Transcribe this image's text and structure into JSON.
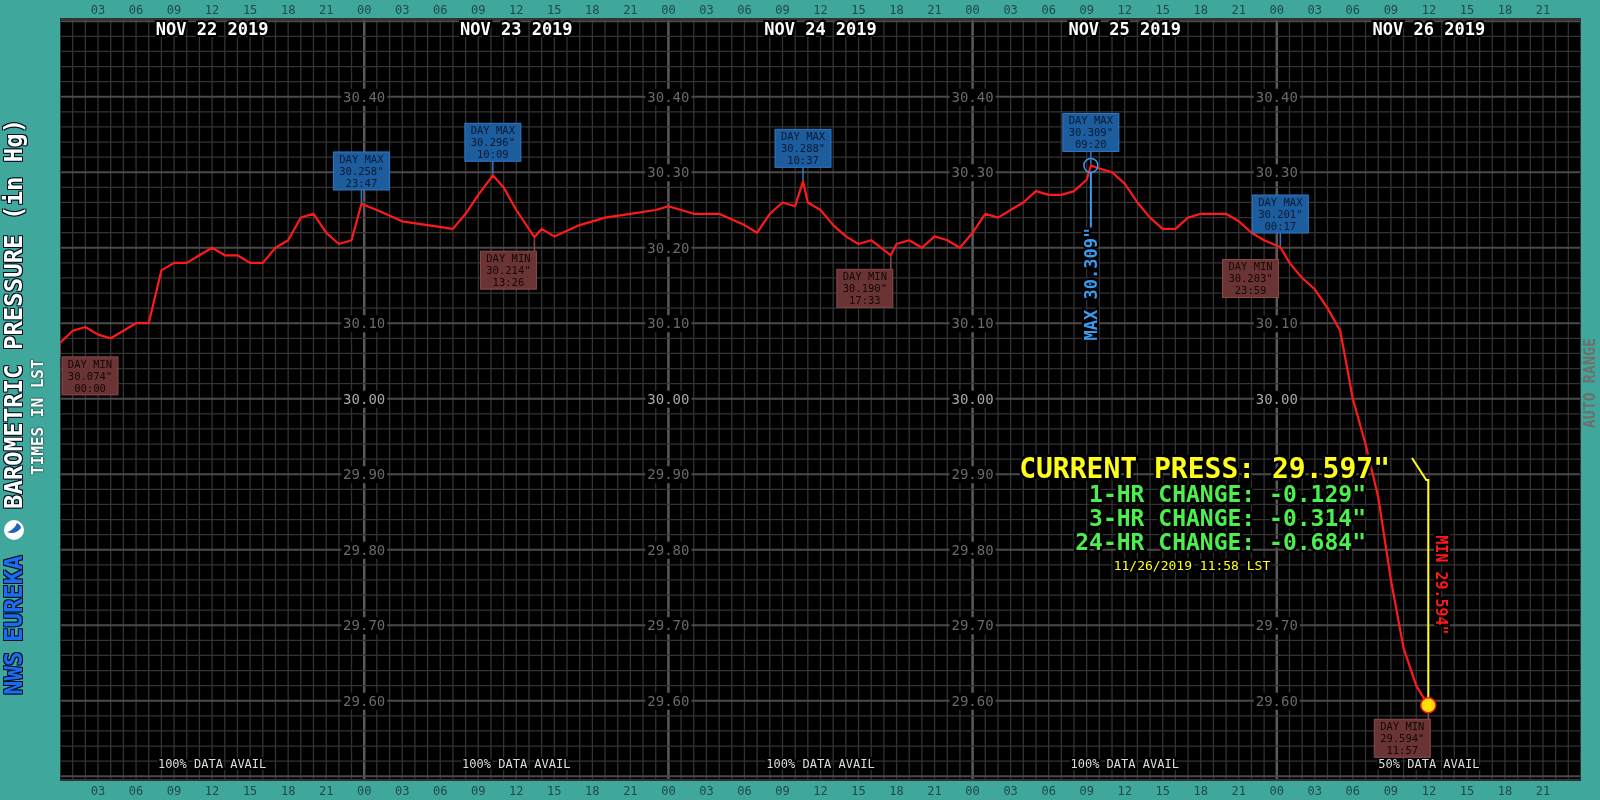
{
  "sidebar": {
    "station": "NWS",
    "office": "EUREKA",
    "title": "BAROMETRIC PRESSURE (in Hg)",
    "subtitle": "TIMES IN LST"
  },
  "right_bar": {
    "label": "AUTO RANGE"
  },
  "chart": {
    "days": [
      {
        "date": "NOV 22 2019",
        "availability": "100% DATA AVAIL",
        "max_tag": [
          "DAY MAX",
          "30.258\"",
          "23:47"
        ],
        "min_tag": [
          "DAY MIN",
          "30.074\"",
          "00:00"
        ]
      },
      {
        "date": "NOV 23 2019",
        "availability": "100% DATA AVAIL",
        "max_tag": [
          "DAY MAX",
          "30.296\"",
          "10:09"
        ],
        "min_tag": [
          "DAY MIN",
          "30.214\"",
          "13:26"
        ]
      },
      {
        "date": "NOV 24 2019",
        "availability": "100% DATA AVAIL",
        "max_tag": [
          "DAY MAX",
          "30.288\"",
          "10:37"
        ],
        "min_tag": [
          "DAY MIN",
          "30.190\"",
          "17:33"
        ]
      },
      {
        "date": "NOV 25 2019",
        "availability": "100% DATA AVAIL",
        "max_tag": [
          "DAY MAX",
          "30.309\"",
          "09:20"
        ],
        "min_tag": [
          "DAY MIN",
          "30.203\"",
          "23:59"
        ]
      },
      {
        "date": "NOV 26 2019",
        "availability": "50% DATA AVAIL",
        "max_tag": [
          "DAY MAX",
          "30.201\"",
          "00:17"
        ],
        "min_tag": [
          "DAY MIN",
          "29.594\"",
          "11:57"
        ]
      }
    ],
    "current": {
      "label": "CURRENT PRESS:",
      "value": "29.597\""
    },
    "changes": [
      {
        "label": "1-HR CHANGE:",
        "value": "-0.129\""
      },
      {
        "label": "3-HR CHANGE:",
        "value": "-0.314\""
      },
      {
        "label": "24-HR CHANGE:",
        "value": "-0.684\""
      }
    ],
    "timestamp": "11/26/2019 11:58 LST",
    "max_label": "MAX 30.309\"",
    "min_label": "MIN 29.594\"",
    "chart_data": {
      "type": "line",
      "grid": true,
      "xlim": [
        0,
        120
      ],
      "ylim": [
        29.495,
        30.503
      ],
      "x": [
        0,
        1,
        2,
        3,
        4,
        5,
        6,
        7,
        8,
        9,
        10,
        11,
        12,
        13,
        14,
        15,
        16,
        17,
        18,
        19,
        20,
        21,
        22,
        23,
        23.78,
        25,
        27,
        29,
        31,
        32,
        33,
        34.15,
        35,
        36,
        37.43,
        38,
        39,
        41,
        43,
        45,
        47,
        48,
        50,
        52,
        54,
        55,
        56,
        57,
        58,
        58.62,
        59,
        60,
        61,
        62,
        63,
        64,
        65.55,
        66,
        67,
        68,
        69,
        70,
        71,
        72,
        73,
        74,
        75,
        76,
        77,
        78,
        79,
        80,
        81,
        81.33,
        82,
        83,
        84,
        85,
        86,
        87,
        88,
        89,
        90,
        91,
        92,
        93,
        94,
        95,
        95.98,
        96.28,
        97,
        98,
        99,
        100,
        101,
        102,
        103,
        104,
        105,
        106,
        107,
        107.95,
        108
      ],
      "series": [
        {
          "color": "#ff1a1a",
          "values": [
            30.074,
            30.09,
            30.095,
            30.085,
            30.08,
            30.09,
            30.1,
            30.1,
            30.17,
            30.18,
            30.18,
            30.19,
            30.2,
            30.19,
            30.19,
            30.18,
            30.18,
            30.2,
            30.21,
            30.24,
            30.245,
            30.22,
            30.205,
            30.21,
            30.258,
            30.25,
            30.235,
            30.23,
            30.225,
            30.245,
            30.27,
            30.296,
            30.28,
            30.25,
            30.214,
            30.225,
            30.215,
            30.23,
            30.24,
            30.245,
            30.25,
            30.255,
            30.245,
            30.245,
            30.23,
            30.22,
            30.245,
            30.26,
            30.255,
            30.288,
            30.26,
            30.25,
            30.23,
            30.215,
            30.205,
            30.21,
            30.19,
            30.205,
            30.21,
            30.2,
            30.215,
            30.21,
            30.2,
            30.22,
            30.245,
            30.24,
            30.25,
            30.26,
            30.275,
            30.27,
            30.27,
            30.275,
            30.29,
            30.309,
            30.305,
            30.3,
            30.285,
            30.26,
            30.24,
            30.225,
            30.225,
            30.24,
            30.245,
            30.245,
            30.245,
            30.235,
            30.22,
            30.21,
            30.203,
            30.201,
            30.18,
            30.16,
            30.145,
            30.12,
            30.09,
            30.0,
            29.94,
            29.87,
            29.76,
            29.67,
            29.62,
            29.594,
            29.597
          ]
        }
      ],
      "xticks": [
        {
          "value": 3,
          "label": "03"
        },
        {
          "value": 6,
          "label": "06"
        },
        {
          "value": 9,
          "label": "09"
        },
        {
          "value": 12,
          "label": "12"
        },
        {
          "value": 15,
          "label": "15"
        },
        {
          "value": 18,
          "label": "18"
        },
        {
          "value": 21,
          "label": "21"
        },
        {
          "value": 24,
          "label": "00"
        },
        {
          "value": 27,
          "label": "03"
        },
        {
          "value": 30,
          "label": "06"
        },
        {
          "value": 33,
          "label": "09"
        },
        {
          "value": 36,
          "label": "12"
        },
        {
          "value": 39,
          "label": "15"
        },
        {
          "value": 42,
          "label": "18"
        },
        {
          "value": 45,
          "label": "21"
        },
        {
          "value": 48,
          "label": "00"
        },
        {
          "value": 51,
          "label": "03"
        },
        {
          "value": 54,
          "label": "06"
        },
        {
          "value": 57,
          "label": "09"
        },
        {
          "value": 60,
          "label": "12"
        },
        {
          "value": 63,
          "label": "15"
        },
        {
          "value": 66,
          "label": "18"
        },
        {
          "value": 69,
          "label": "21"
        },
        {
          "value": 72,
          "label": "00"
        },
        {
          "value": 75,
          "label": "03"
        },
        {
          "value": 78,
          "label": "06"
        },
        {
          "value": 81,
          "label": "09"
        },
        {
          "value": 84,
          "label": "12"
        },
        {
          "value": 87,
          "label": "15"
        },
        {
          "value": 90,
          "label": "18"
        },
        {
          "value": 93,
          "label": "21"
        },
        {
          "value": 96,
          "label": "00"
        },
        {
          "value": 99,
          "label": "03"
        },
        {
          "value": 102,
          "label": "06"
        },
        {
          "value": 105,
          "label": "09"
        },
        {
          "value": 108,
          "label": "12"
        },
        {
          "value": 111,
          "label": "15"
        },
        {
          "value": 114,
          "label": "18"
        },
        {
          "value": 117,
          "label": "21"
        }
      ],
      "yticks": [
        {
          "value": 30.4,
          "label": "30.40"
        },
        {
          "value": 30.3,
          "label": "30.30"
        },
        {
          "value": 30.2,
          "label": "30.20"
        },
        {
          "value": 30.1,
          "label": "30.10"
        },
        {
          "value": 30.0,
          "label": "30.00"
        },
        {
          "value": 29.9,
          "label": "29.90"
        },
        {
          "value": 29.8,
          "label": "29.80"
        },
        {
          "value": 29.7,
          "label": "29.70"
        },
        {
          "value": 29.6,
          "label": "29.60"
        }
      ]
    }
  }
}
